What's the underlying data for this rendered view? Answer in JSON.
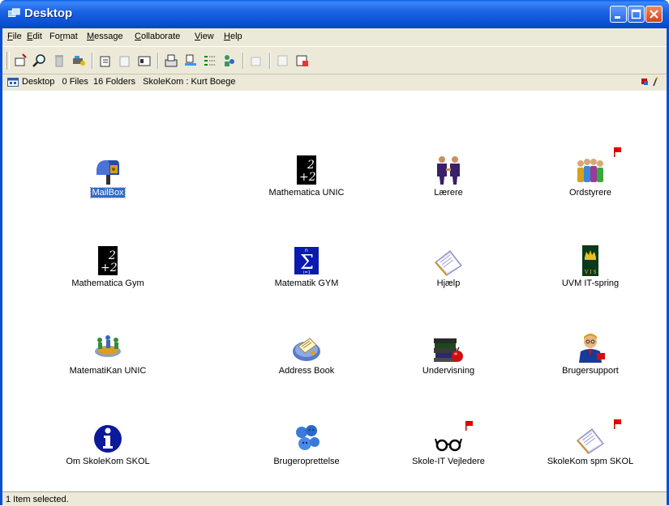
{
  "window": {
    "title": "Desktop",
    "minimize_label": "Minimize",
    "maximize_label": "Maximize",
    "close_label": "Close"
  },
  "menu": {
    "items": [
      {
        "label": "File",
        "key": "F"
      },
      {
        "label": "Edit",
        "key": "E"
      },
      {
        "label": "Format",
        "key": "r"
      },
      {
        "label": "Message",
        "key": "M"
      },
      {
        "label": "Collaborate",
        "key": "C"
      },
      {
        "label": "View",
        "key": "V"
      },
      {
        "label": "Help",
        "key": "H"
      }
    ]
  },
  "toolbar": {
    "buttons": [
      "new-message-icon",
      "find-icon",
      "trash-icon",
      "tools-icon",
      "reply-icon",
      "forward-icon",
      "properties-icon",
      "fax-icon",
      "print-icon",
      "list-icon",
      "users-icon",
      "history-icon",
      "open-icon",
      "archive-icon"
    ]
  },
  "pathbar": {
    "text": "Desktop   0 Files  16 Folders   SkoleKom : Kurt Boege"
  },
  "desktop": {
    "items": [
      {
        "label": "MailBox",
        "icon": "mailbox-icon",
        "selected": true,
        "flag": false
      },
      {
        "label": "Mathematica UNIC",
        "icon": "mathematica-icon",
        "selected": false,
        "flag": false
      },
      {
        "label": "Lærere",
        "icon": "people-icon",
        "selected": false,
        "flag": false
      },
      {
        "label": "Ordstyrere",
        "icon": "group-icon",
        "selected": false,
        "flag": true
      },
      {
        "label": "Mathematica Gym",
        "icon": "mathematica-icon",
        "selected": false,
        "flag": false
      },
      {
        "label": "Matematik GYM",
        "icon": "sigma-icon",
        "selected": false,
        "flag": false
      },
      {
        "label": "Hjælp",
        "icon": "help-book-icon",
        "selected": false,
        "flag": false
      },
      {
        "label": "UVM IT-spring",
        "icon": "crown-icon",
        "selected": false,
        "flag": false
      },
      {
        "label": "MatematiKan UNIC",
        "icon": "conference-icon",
        "selected": false,
        "flag": false
      },
      {
        "label": "Address Book",
        "icon": "address-book-icon",
        "selected": false,
        "flag": false
      },
      {
        "label": "Undervisning",
        "icon": "books-apple-icon",
        "selected": false,
        "flag": false
      },
      {
        "label": "Brugersupport",
        "icon": "support-person-icon",
        "selected": false,
        "flag": false
      },
      {
        "label": "Om SkoleKom SKOL",
        "icon": "info-icon",
        "selected": false,
        "flag": false
      },
      {
        "label": "Brugeroprettelse",
        "icon": "users-blue-icon",
        "selected": false,
        "flag": false
      },
      {
        "label": "Skole-IT Vejledere",
        "icon": "glasses-icon",
        "selected": false,
        "flag": true
      },
      {
        "label": "SkoleKom spm SKOL",
        "icon": "help-book-icon",
        "selected": false,
        "flag": true
      }
    ]
  },
  "status": {
    "text": "1 Item selected."
  },
  "colors": {
    "titlebar": "#0a4fd2",
    "selection": "#316ac5",
    "chrome": "#ece9d8",
    "flag": "#e00000"
  }
}
